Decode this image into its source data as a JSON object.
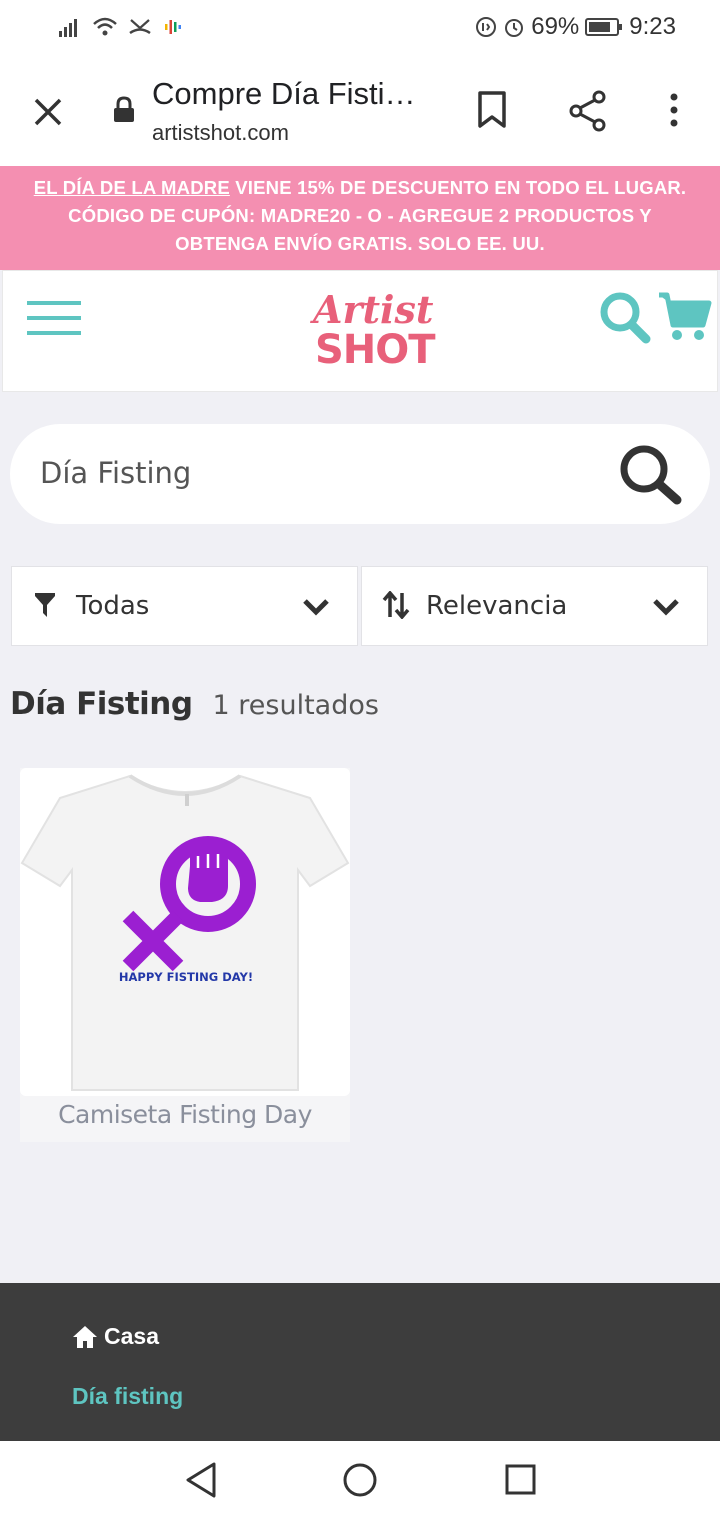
{
  "status": {
    "battery": "69%",
    "time": "9:23"
  },
  "browser": {
    "page_title": "Compre Día Fisti…",
    "url": "artistshot.com"
  },
  "promo": {
    "highlight": "EL DÍA DE LA MADRE",
    "line1_rest": " VIENE 15% DE DESCUENTO EN TODO EL LUGAR.",
    "line2": "CÓDIGO DE CUPÓN: MADRE20 - O - AGREGUE 2 PRODUCTOS Y",
    "line3": "OBTENGA ENVÍO GRATIS. SOLO EE. UU."
  },
  "logo": {
    "top": "Artist",
    "bottom": "SHOT"
  },
  "search": {
    "value": "Día Fisting"
  },
  "filters": {
    "category": "Todas",
    "sort": "Relevancia"
  },
  "results": {
    "query": "Día Fisting",
    "count_text": "1 resultados"
  },
  "products": [
    {
      "name": "Camiseta Fisting Day",
      "print_text": "HAPPY FISTING DAY!",
      "print_color": "#9b1fd1"
    }
  ],
  "footer": {
    "home_label": "Casa",
    "current_label": "Día fisting"
  },
  "colors": {
    "accent": "#5ec5c1",
    "promo_bg": "#f48fb1",
    "brand": "#e8607a"
  }
}
